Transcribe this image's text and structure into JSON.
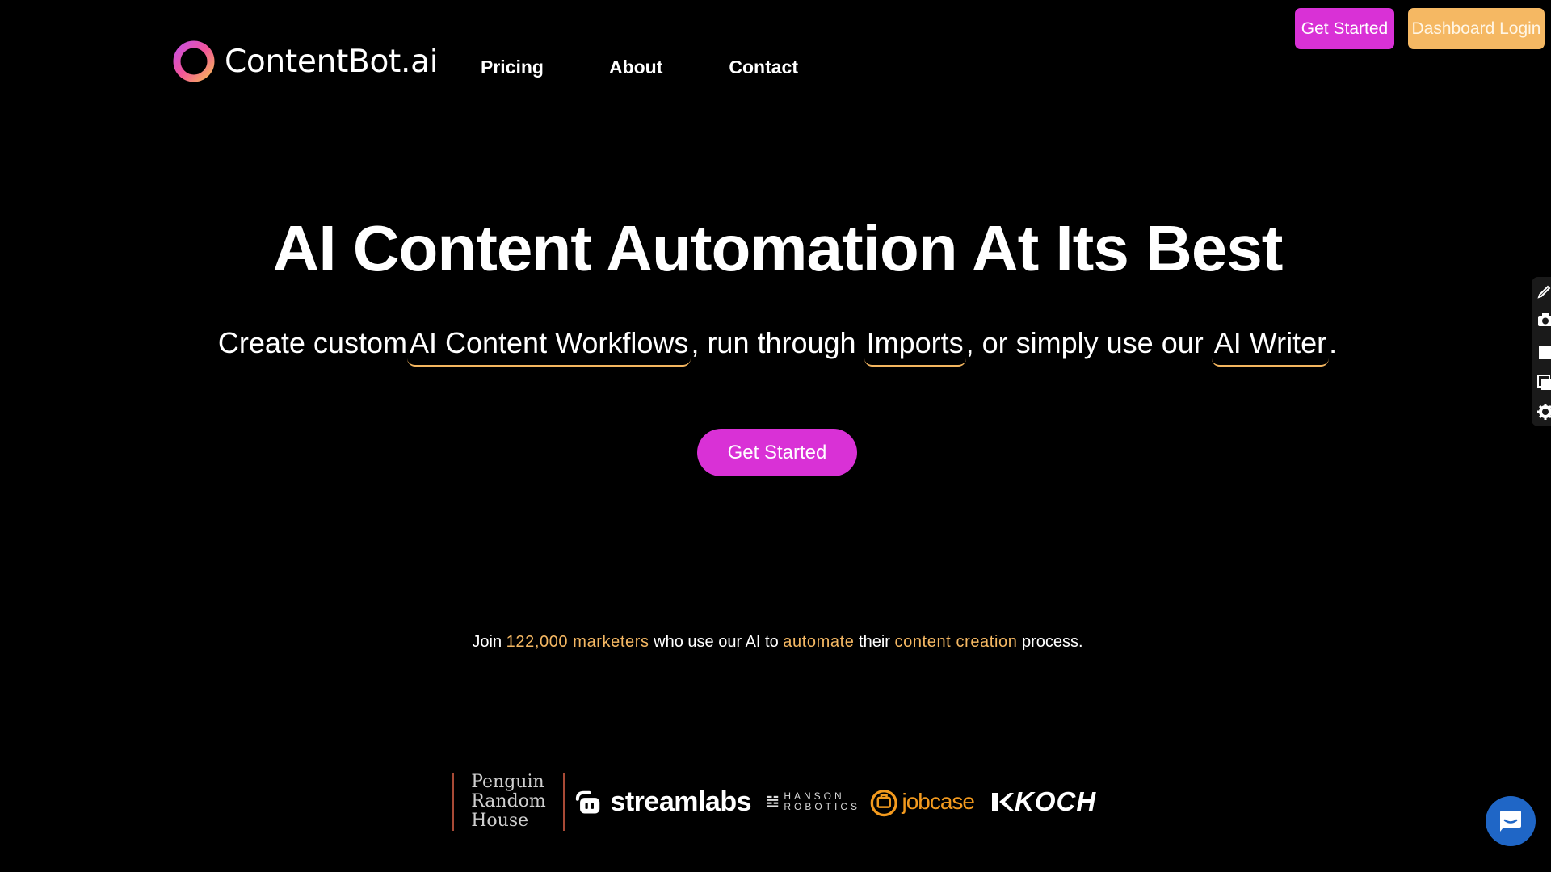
{
  "header": {
    "logo_text": "ContentBot.ai",
    "nav": [
      {
        "label": "Pricing"
      },
      {
        "label": "About"
      },
      {
        "label": "Contact"
      }
    ],
    "get_started_label": "Get Started",
    "dashboard_login_label": "Dashboard Login"
  },
  "hero": {
    "title": "AI Content Automation At Its Best",
    "subtitle": {
      "prefix": "Create custom",
      "link1": "AI Content Workflows",
      "mid1": ", run through",
      "link2": "Imports",
      "mid2": ", or simply use our",
      "link3": "AI Writer",
      "suffix": "."
    },
    "cta_label": "Get Started"
  },
  "social_proof": {
    "t1": "Join ",
    "h1": "122,000 marketers",
    "t2": " who use our AI to ",
    "h2": "automate",
    "t3": " their ",
    "h3": "content creation",
    "t4": " process."
  },
  "logos": {
    "penguin_lines": [
      "Penguin",
      "Random",
      "House"
    ],
    "streamlabs": "streamlabs",
    "hanson_lines": [
      "HANSON",
      "ROBOTICS"
    ],
    "jobcase": "jobcase",
    "koch": "KOCH"
  },
  "colors": {
    "background": "#000000",
    "accent_magenta": "#d931d6",
    "accent_orange": "#f5b863",
    "chat_blue": "#1f66c6"
  },
  "icons": {
    "side_tools": [
      "edit-icon",
      "camera-icon",
      "square-icon",
      "copy-icon",
      "gear-icon"
    ],
    "chat": "chat-icon"
  }
}
